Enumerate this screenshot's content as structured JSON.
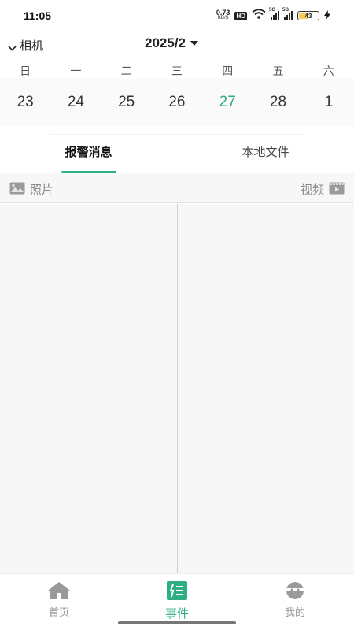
{
  "status_bar": {
    "time": "11:05",
    "net_speed_value": "0.73",
    "net_speed_unit": "KB/S",
    "hd_badge": "HD",
    "signal1_label": "5G",
    "signal2_label": "5G",
    "battery": "43",
    "icons": [
      "wifi-icon",
      "signal-icon",
      "battery-icon",
      "charging-icon"
    ]
  },
  "header": {
    "camera_label": "相机",
    "month_label": "2025/2"
  },
  "calendar": {
    "weekdays": [
      "日",
      "一",
      "二",
      "三",
      "四",
      "五",
      "六"
    ],
    "dates": [
      "23",
      "24",
      "25",
      "26",
      "27",
      "28",
      "1"
    ],
    "selected_index": 4
  },
  "tabs": [
    {
      "label": "报警消息",
      "active": true
    },
    {
      "label": "本地文件",
      "active": false
    }
  ],
  "media": {
    "photo_label": "照片",
    "video_label": "视频"
  },
  "bottom_nav": [
    {
      "label": "首页",
      "icon": "home-icon",
      "active": false
    },
    {
      "label": "事件",
      "icon": "events-icon",
      "active": true
    },
    {
      "label": "我的",
      "icon": "profile-icon",
      "active": false
    }
  ],
  "colors": {
    "accent": "#2fae83",
    "muted": "#999999"
  }
}
